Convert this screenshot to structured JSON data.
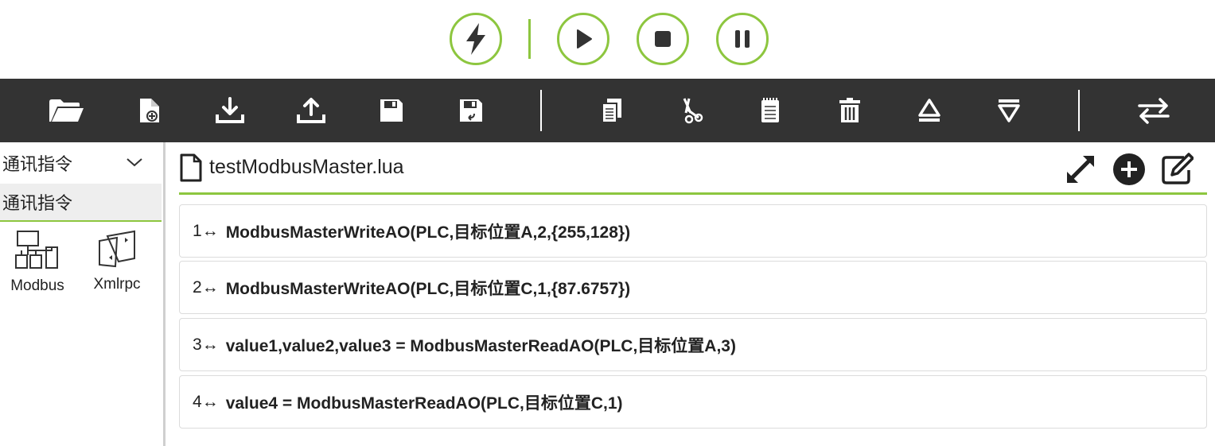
{
  "controls": {
    "accent": "#8dc63f",
    "items": [
      {
        "name": "lightning-button",
        "icon": "lightning-icon"
      },
      {
        "name": "play-button",
        "icon": "play-icon"
      },
      {
        "name": "stop-button",
        "icon": "stop-icon"
      },
      {
        "name": "pause-button",
        "icon": "pause-icon"
      }
    ]
  },
  "toolbar": {
    "background": "#333333",
    "icons": [
      "folder-open-icon",
      "new-file-icon",
      "download-icon",
      "upload-icon",
      "save-icon",
      "save-as-icon",
      "copy-icon",
      "cut-icon",
      "paste-icon",
      "delete-icon",
      "move-up-icon",
      "move-down-icon",
      "swap-icon"
    ]
  },
  "sidebar": {
    "category_select": "通讯指令",
    "active_category": "通讯指令",
    "protocols": [
      {
        "label": "Modbus",
        "icon": "modbus-network-icon"
      },
      {
        "label": "Xmlrpc",
        "icon": "xmlrpc-icon"
      }
    ]
  },
  "editor": {
    "file_name": "testModbusMaster.lua",
    "actions": [
      "expand-icon",
      "add-circle-icon",
      "edit-icon"
    ],
    "lines": [
      {
        "num": "1",
        "arrow": "↔",
        "code": "ModbusMasterWriteAO(PLC,目标位置A,2,{255,128})"
      },
      {
        "num": "2",
        "arrow": "↔",
        "code": "ModbusMasterWriteAO(PLC,目标位置C,1,{87.6757})"
      },
      {
        "num": "3",
        "arrow": "↔",
        "code": "value1,value2,value3 = ModbusMasterReadAO(PLC,目标位置A,3)"
      },
      {
        "num": "4",
        "arrow": "↔",
        "code": "value4 = ModbusMasterReadAO(PLC,目标位置C,1)"
      }
    ]
  }
}
